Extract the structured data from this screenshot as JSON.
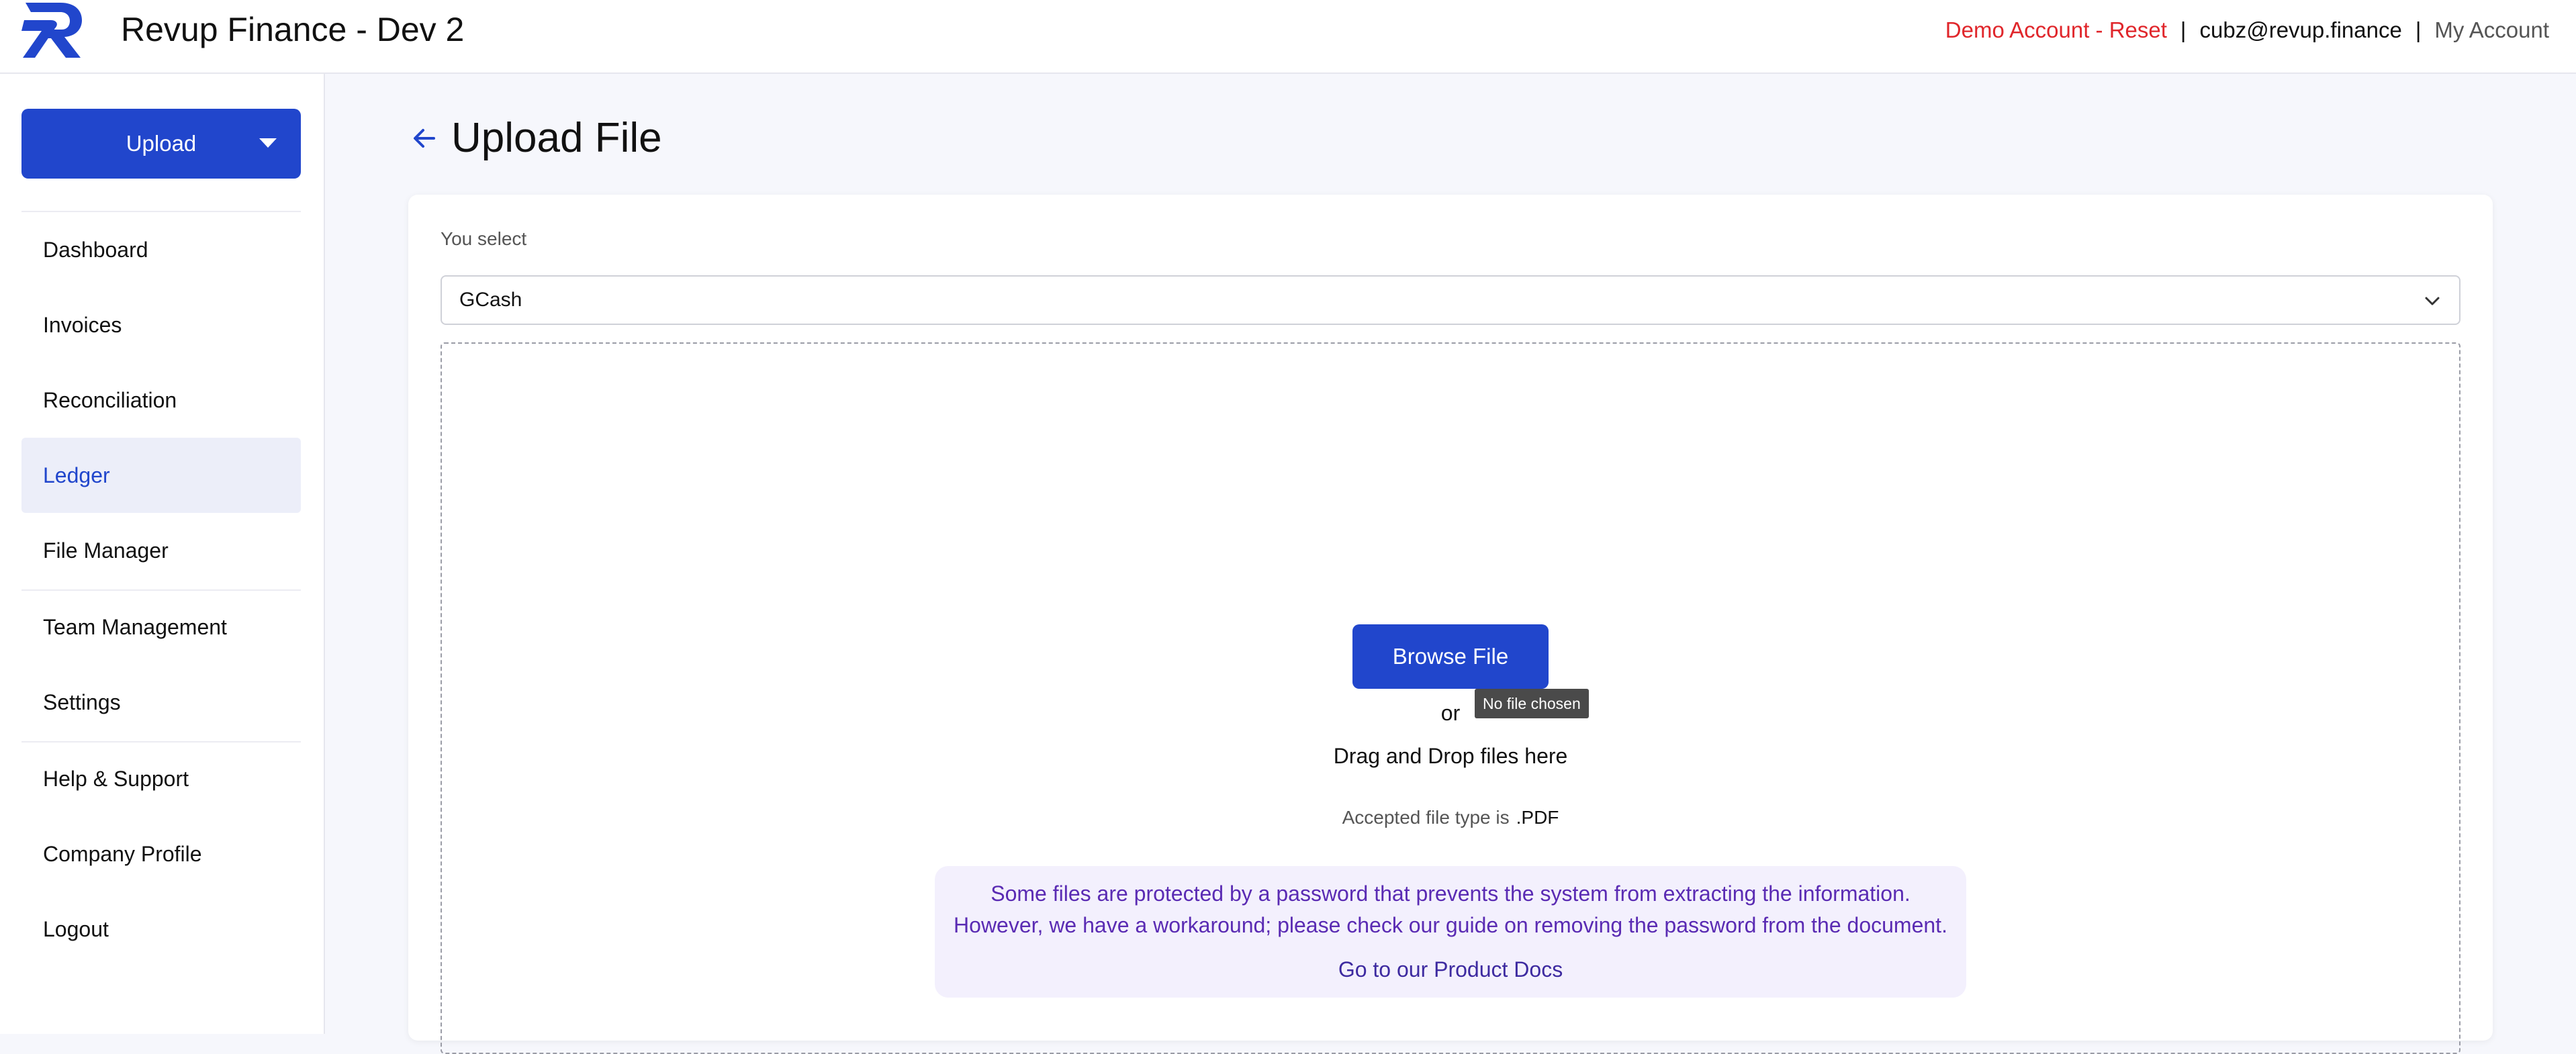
{
  "header": {
    "app_title": "Revup Finance - Dev 2",
    "demo_reset": "Demo Account - Reset",
    "separator": "|",
    "user_email": "cubz@revup.finance",
    "my_account": "My Account",
    "logo_icon": "revup-logo-icon",
    "brand_color": "#2146cc",
    "demo_color": "#e0262b"
  },
  "sidebar": {
    "upload_label": "Upload",
    "items": [
      {
        "label": "Dashboard"
      },
      {
        "label": "Invoices"
      },
      {
        "label": "Reconciliation"
      },
      {
        "label": "Ledger",
        "active": true
      },
      {
        "label": "File Manager"
      },
      {
        "label": "Team Management"
      },
      {
        "label": "Settings"
      },
      {
        "label": "Help & Support"
      },
      {
        "label": "Company Profile"
      },
      {
        "label": "Logout"
      }
    ]
  },
  "main": {
    "title": "Upload File",
    "select_label": "You select",
    "select_value": "GCash",
    "browse_label": "Browse File",
    "file_status": "No file chosen",
    "or_text": "or",
    "drag_text": "Drag and Drop files here",
    "accepted_label": "Accepted file type is",
    "accepted_type": ".PDF",
    "notice_line1": "Some files are protected by a password that prevents the system from extracting the information.",
    "notice_line2": "However, we have a workaround; please check our guide on removing the password from the document.",
    "docs_link": "Go to our Product Docs"
  }
}
